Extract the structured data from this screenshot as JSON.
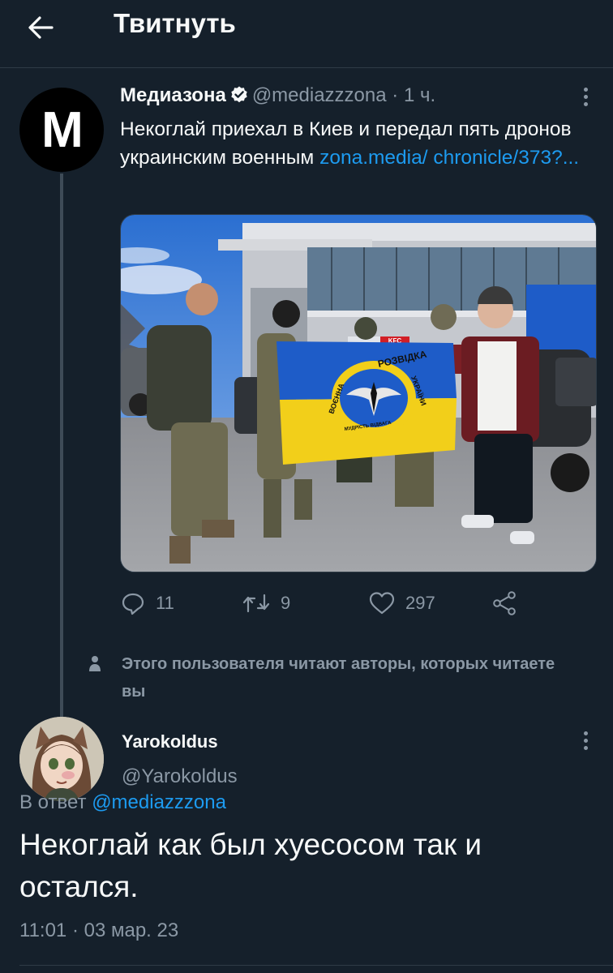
{
  "header": {
    "title": "Твитнуть",
    "back_icon": "arrow-left-icon"
  },
  "original_tweet": {
    "avatar_letter": "M",
    "author_name": "Медиазона",
    "verified": true,
    "handle": "@mediazzzona",
    "separator": "·",
    "time": "1 ч.",
    "text": "Некоглай приехал в Киев и передал пять дронов украинским военным ",
    "link": "zona.media/ chronicle/373?...",
    "flag_text_top": "РОЗВІДКА",
    "flag_text_left": "ВОЄННА",
    "flag_text_right": "УКРАЇНИ",
    "flag_text_bottom": "МУДРІСТЬ ВІДВАГА",
    "store_sign": "KFC",
    "actions": {
      "replies": "11",
      "retweets": "9",
      "likes": "297"
    }
  },
  "social_context": "Этого пользователя читают авторы, которых читаете вы",
  "reply_tweet": {
    "author_name": "Yarokoldus",
    "handle": "@Yarokoldus",
    "in_reply_prefix": "В ответ ",
    "in_reply_handle": "@mediazzzona",
    "text": "Некоглай как был хуесосом так и остался.",
    "timestamp": "11:01 · 03 мар. 23"
  },
  "colors": {
    "background": "#15202b",
    "link": "#1d9bf0",
    "muted": "#8b98a5",
    "verified": "#f7f9f9"
  }
}
